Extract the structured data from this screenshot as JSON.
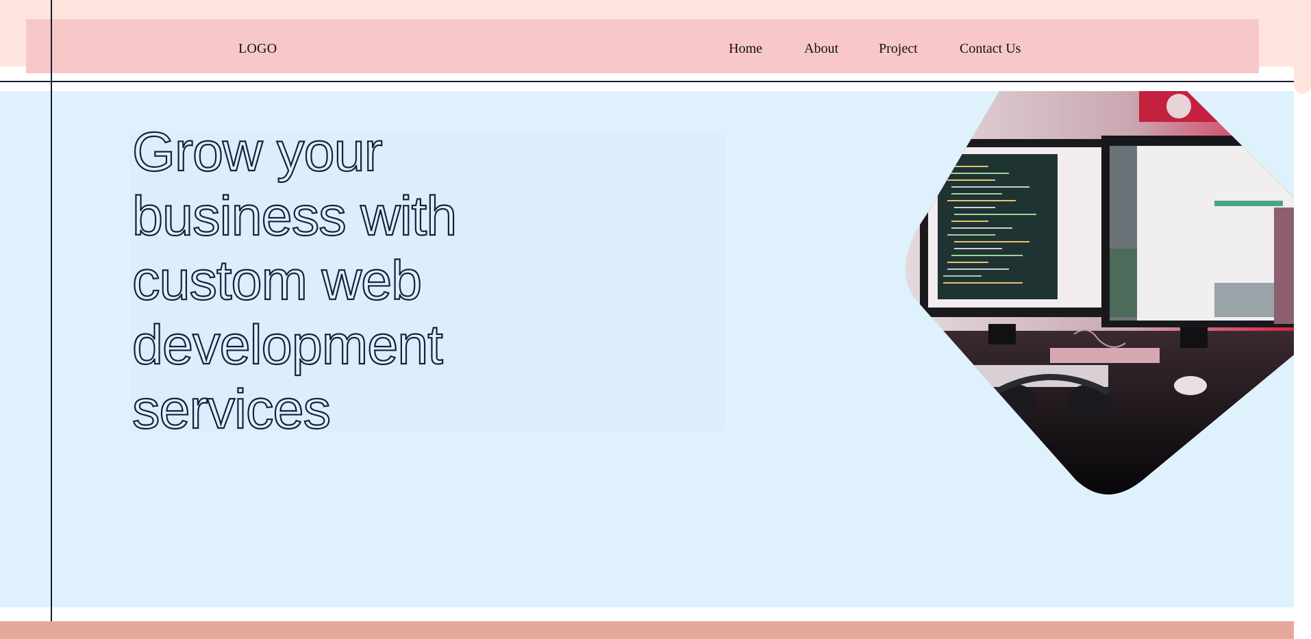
{
  "header": {
    "logo": "LOGO",
    "nav": {
      "home": "Home",
      "about": "About",
      "project": "Project",
      "contact": "Contact Us"
    }
  },
  "hero": {
    "headline_lines": [
      "Grow your",
      "business with",
      "custom web",
      "development",
      "services"
    ]
  },
  "colors": {
    "top_band": "#ffe3dd",
    "navbar": "#f8c8c9",
    "hero_background": "#dff1fc",
    "headline_outline": "#14213d",
    "footer_band": "#e7a89c"
  }
}
